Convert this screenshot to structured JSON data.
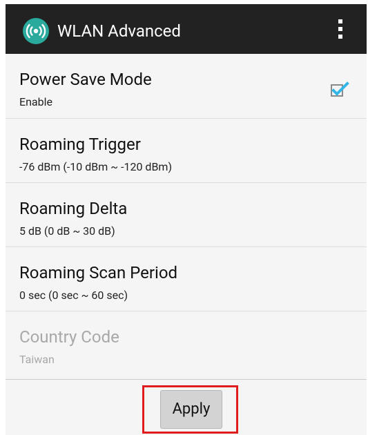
{
  "app_bar": {
    "title": "WLAN Advanced",
    "icon": "wifi-antenna-icon",
    "menu_icon": "overflow-menu-icon",
    "color": "#222222",
    "icon_color": "#2aa99d"
  },
  "settings": [
    {
      "title": "Power Save Mode",
      "subtitle": "Enable",
      "checked": true,
      "enabled": true
    },
    {
      "title": "Roaming Trigger",
      "subtitle": "-76 dBm  (-10 dBm ~ -120 dBm)",
      "enabled": true
    },
    {
      "title": "Roaming Delta",
      "subtitle": "5 dB  (0 dB ~ 30 dB)",
      "enabled": true
    },
    {
      "title": "Roaming Scan Period",
      "subtitle": "0 sec (0 sec ~ 60 sec)",
      "enabled": true
    },
    {
      "title": "Country Code",
      "subtitle": "Taiwan",
      "enabled": false
    }
  ],
  "footer": {
    "apply_label": "Apply",
    "highlight_color": "#e01c1c"
  },
  "colors": {
    "accent": "#33b5e5",
    "disabled_text": "#a8a8a8"
  }
}
